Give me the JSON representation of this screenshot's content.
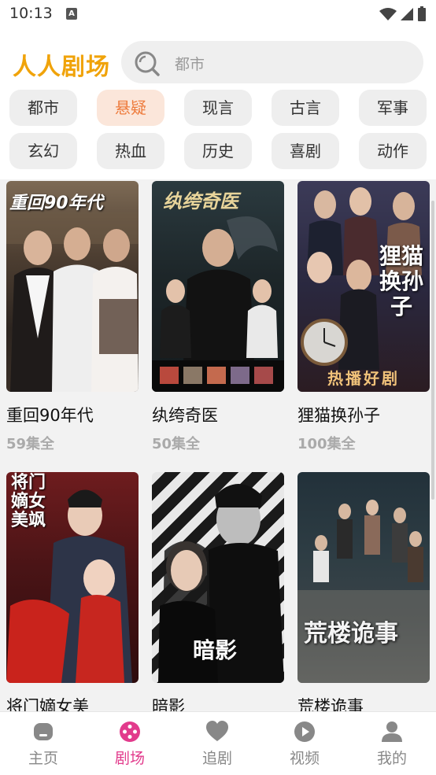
{
  "status_bar": {
    "time": "10:13"
  },
  "header": {
    "brand": "人人剧场",
    "search_value": "都市"
  },
  "categories": [
    "都市",
    "悬疑",
    "现言",
    "古言",
    "军事",
    "玄幻",
    "热血",
    "历史",
    "喜剧",
    "动作"
  ],
  "active_category": "悬疑",
  "shows": [
    {
      "title": "重回90年代",
      "episodes": "59集全",
      "poster_text": "重回90年代"
    },
    {
      "title": "纨绔奇医",
      "episodes": "50集全",
      "poster_text": "纨绔奇医"
    },
    {
      "title": "狸猫换孙子",
      "episodes": "100集全",
      "poster_text": "狸猫换孙子",
      "poster_banner": "热播好剧"
    },
    {
      "title": "将门嫡女美",
      "episodes": "",
      "poster_text": "将门嫡女美飒"
    },
    {
      "title": "暗影",
      "episodes": "",
      "poster_text": "暗影"
    },
    {
      "title": "荒楼诡事",
      "episodes": "",
      "poster_text": "荒楼诡事"
    }
  ],
  "bottom_nav": [
    {
      "label": "主页",
      "icon": "home-icon"
    },
    {
      "label": "剧场",
      "icon": "theater-icon"
    },
    {
      "label": "追剧",
      "icon": "heart-icon"
    },
    {
      "label": "视频",
      "icon": "play-icon"
    },
    {
      "label": "我的",
      "icon": "profile-icon"
    }
  ],
  "active_nav": "剧场",
  "colors": {
    "brand": "#f0a30a",
    "active_chip_text": "#ee7b3c",
    "active_chip_bg": "#fbe6da",
    "active_nav": "#e23b8c"
  }
}
